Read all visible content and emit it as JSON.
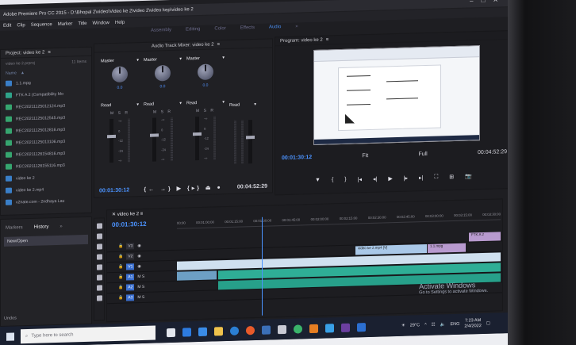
{
  "app": {
    "title": "Adobe Premiere Pro CC 2015 - D:\\Bhopal 2\\video\\Video ke 2\\video 2\\video kep\\video ke 2",
    "window_controls": [
      "–",
      "□",
      "✕"
    ]
  },
  "menu": [
    "Edit",
    "Clip",
    "Sequence",
    "Marker",
    "Title",
    "Window",
    "Help"
  ],
  "workspaces": {
    "items": [
      "Assembly",
      "Editing",
      "Color",
      "Effects",
      "Audio",
      "»"
    ],
    "active_index": 4
  },
  "project_panel": {
    "title": "Project: video ke 2",
    "menu_icon": "≡",
    "search_label": "video ke 2.prproj",
    "items_count": "11 Items",
    "column_name": "Name",
    "items": [
      {
        "name": "1.1.mpg",
        "kind": "video"
      },
      {
        "name": "FTK A 2 (Compatibility Mo",
        "kind": "image"
      },
      {
        "name": "REC20211125012124.mp3",
        "kind": "audio"
      },
      {
        "name": "REC20211125012545.mp3",
        "kind": "audio"
      },
      {
        "name": "REC20211125012816.mp3",
        "kind": "audio"
      },
      {
        "name": "REC20211125013106.mp3",
        "kind": "audio"
      },
      {
        "name": "REC20211126154816.mp3",
        "kind": "audio"
      },
      {
        "name": "REC20211126155116.mp3",
        "kind": "audio"
      },
      {
        "name": "video ke 2",
        "kind": "sequence"
      },
      {
        "name": "video ke 2.mp4",
        "kind": "video"
      },
      {
        "name": "v2nate.com - 2ndhaya Lau",
        "kind": "video"
      }
    ]
  },
  "audio_mixer": {
    "title": "Audio Track Mixer: video ke 2",
    "channels": [
      {
        "label": "Master",
        "knob_value": "0.0",
        "mode": "Read",
        "level": "0.0"
      },
      {
        "label": "Master",
        "knob_value": "0.0",
        "mode": "Read",
        "level": "0.0"
      },
      {
        "label": "Master",
        "knob_value": "0.0",
        "mode": "Read",
        "level": "0.0"
      }
    ],
    "last_mode": "Read",
    "msr": "M S R",
    "scale": [
      "-∞",
      "6",
      "0",
      "-6",
      "-12",
      "-18",
      "-24",
      "-36",
      "-∞"
    ],
    "timecode_current": "00:01:30:12",
    "timecode_duration": "00:04:52:29",
    "transport": "{← →} ▶ {▸} ⏏ ●"
  },
  "program_monitor": {
    "title": "Program: video ke 2",
    "timecode_current": "00:01:30:12",
    "fit_label": "Fit",
    "quality": "Full",
    "timecode_duration": "00:04:52:29",
    "controls": [
      "▼",
      "{",
      "}",
      "|◂",
      "◂|",
      "▶",
      "|▸",
      "▸|",
      "⛶",
      "⊞",
      "📷"
    ]
  },
  "history_panel": {
    "tabs": [
      "Markers",
      "History",
      "»"
    ],
    "selected_tab": 1,
    "rows": [
      "New/Open"
    ],
    "undos_label": "Undos"
  },
  "timeline": {
    "tab_label": "video ke 2",
    "timecode": "00:01:30:12",
    "ruler": [
      "00:00",
      "00:01:00:00",
      "00:01:15:00",
      "00:01:30:00",
      "00:01:45:00",
      "00:02:00:00",
      "00:02:15:00",
      "00:02:30:00",
      "00:02:45:00",
      "00:03:00:00",
      "00:03:15:00",
      "00:03:30:00"
    ],
    "tracks": [
      {
        "name": "V3",
        "type": "video",
        "on": false
      },
      {
        "name": "V2",
        "type": "video",
        "on": false
      },
      {
        "name": "V1",
        "type": "video",
        "on": true
      },
      {
        "name": "A1",
        "type": "audio",
        "on": true
      },
      {
        "name": "A2",
        "type": "audio",
        "on": true
      },
      {
        "name": "A3",
        "type": "audio",
        "on": true
      }
    ],
    "clips": {
      "v3_label": "FTK A 2",
      "v2_label_1": "video ke 2.mp4 [V]",
      "v2_label_2": "1.1.mpg"
    }
  },
  "watermark": {
    "line1": "Activate Windows",
    "line2": "Go to Settings to activate Windows."
  },
  "taskbar": {
    "search_placeholder": "Type here to search",
    "weather": "29°C",
    "time": "7:23 AM",
    "date": "2/4/2022",
    "lang": "ENG"
  },
  "colors": {
    "accent_blue": "#4b93ff",
    "audio_clip": "#2fae96",
    "video_clip": "#a9c8e8",
    "panel_bg": "#232327"
  }
}
